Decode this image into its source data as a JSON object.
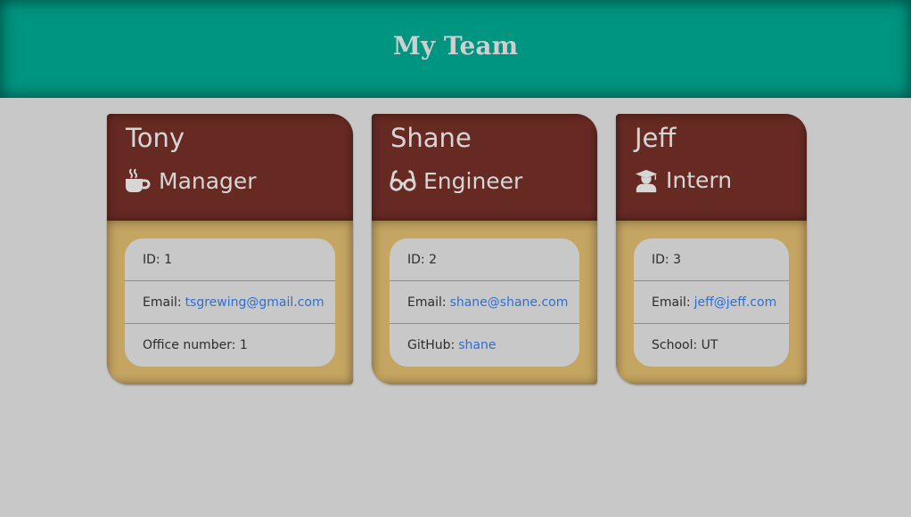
{
  "header": {
    "title": "My Team"
  },
  "cards": [
    {
      "name": "Tony",
      "role": "Manager",
      "icon": "coffee-mug-icon",
      "id_label": "ID: 1",
      "email_label": "Email:",
      "email": "tsgrewing@gmail.com",
      "extra_label": "Office number: 1",
      "extra_link": ""
    },
    {
      "name": "Shane",
      "role": "Engineer",
      "icon": "glasses-icon",
      "id_label": "ID: 2",
      "email_label": "Email:",
      "email": "shane@shane.com",
      "extra_label": "GitHub:",
      "extra_link": "shane"
    },
    {
      "name": "Jeff",
      "role": "Intern",
      "icon": "graduate-icon",
      "id_label": "ID: 3",
      "email_label": "Email:",
      "email": "jeff@jeff.com",
      "extra_label": "School: UT",
      "extra_link": ""
    }
  ],
  "colors": {
    "header": "#009581",
    "card_top": "#662a22",
    "card_bottom": "#c5a562",
    "link": "#2b6fd6",
    "background": "#c8c8c8"
  }
}
